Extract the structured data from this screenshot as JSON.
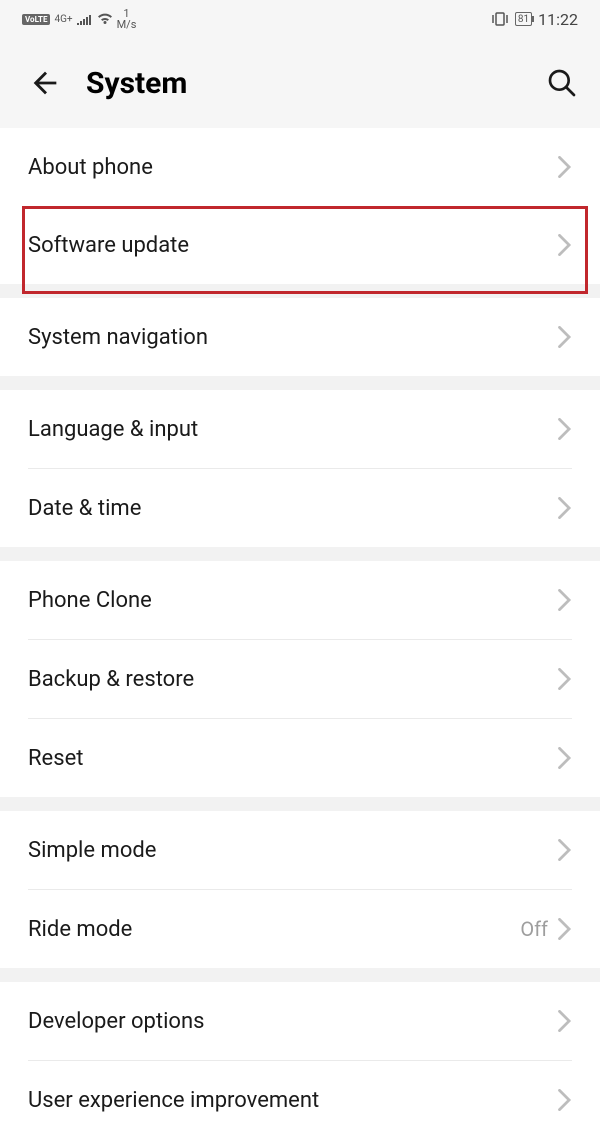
{
  "status": {
    "volte": "VoLTE",
    "network": "4G+",
    "speed_value": "1",
    "speed_unit": "M/s",
    "battery": "81",
    "time": "11:22"
  },
  "header": {
    "title": "System"
  },
  "groups": [
    {
      "items": [
        {
          "label": "About phone",
          "value": null
        },
        {
          "label": "Software update",
          "value": null,
          "highlighted": true
        }
      ]
    },
    {
      "items": [
        {
          "label": "System navigation",
          "value": null
        }
      ]
    },
    {
      "items": [
        {
          "label": "Language & input",
          "value": null
        },
        {
          "label": "Date & time",
          "value": null
        }
      ]
    },
    {
      "items": [
        {
          "label": "Phone Clone",
          "value": null
        },
        {
          "label": "Backup & restore",
          "value": null
        },
        {
          "label": "Reset",
          "value": null
        }
      ]
    },
    {
      "items": [
        {
          "label": "Simple mode",
          "value": null
        },
        {
          "label": "Ride mode",
          "value": "Off"
        }
      ]
    },
    {
      "items": [
        {
          "label": "Developer options",
          "value": null
        },
        {
          "label": "User experience improvement",
          "value": null
        }
      ]
    }
  ]
}
